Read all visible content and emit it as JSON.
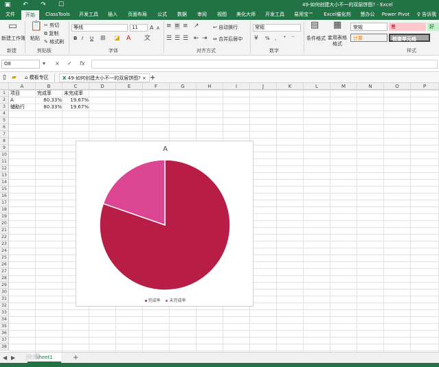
{
  "window": {
    "title": "49-如何创建大小不一的双层饼图? - Excel"
  },
  "quick_access": [
    "save-icon",
    "undo-icon",
    "redo-icon",
    "touch-icon"
  ],
  "ribbon_tabs": [
    "文件",
    "开始",
    "ClassTools",
    "开发工具",
    "插入",
    "页面布局",
    "公式",
    "数据",
    "审阅",
    "视图",
    "美化大师",
    "开发工具",
    "易用宝™",
    "Excel催化剂",
    "慧办公",
    "Power Pivot"
  ],
  "active_tab": "开始",
  "tell_me": "告诉我",
  "ribbon": {
    "groups": [
      "剪贴板",
      "字体",
      "对齐方式",
      "数字",
      "样式"
    ],
    "first_group_label": "新建",
    "new_workbook": "新建工作簿",
    "paste": "粘贴",
    "cut": "剪切",
    "copy": "复制",
    "format_painter": "格式刷",
    "font_name": "等线",
    "font_size": "11",
    "bold": "B",
    "italic": "I",
    "underline": "U",
    "wrap_text": "自动换行",
    "merge_center": "合并后居中",
    "number_format": "常规",
    "percent": "%",
    "comma": ",",
    "conditional_format": "条件格式",
    "table_format": "套用表格格式",
    "styles": [
      {
        "label": "常规",
        "bg": "#ffffff",
        "color": "#222222"
      },
      {
        "label": "差",
        "bg": "#ffc7ce",
        "color": "#9c0006"
      },
      {
        "label": "好",
        "bg": "#c6efce",
        "color": "#006100"
      },
      {
        "label": "计算",
        "bg": "#f2f2f2",
        "color": "#fa7d00"
      },
      {
        "label": "检查单元格",
        "bg": "#a5a5a5",
        "color": "#ffffff"
      }
    ]
  },
  "formula_bar": {
    "name_box": "O8",
    "cancel": "×",
    "enter": "✓",
    "fx": "fx",
    "value": ""
  },
  "file_tabs": {
    "home": "模板专区",
    "current": "49-如何创建大小不一的双层饼图?"
  },
  "columns": [
    "A",
    "B",
    "C",
    "D",
    "E",
    "F",
    "G",
    "H",
    "I",
    "J",
    "K",
    "L",
    "M",
    "N",
    "O",
    "P"
  ],
  "rows_count": 38,
  "cells": {
    "A1": "项目",
    "B1": "完成率",
    "C1": "未完成率",
    "A2": "A",
    "B2": "80.33%",
    "C2": "19.67%",
    "A3": "辅助行",
    "B3": "80.33%",
    "C3": "19.67%"
  },
  "chart_data": {
    "type": "pie",
    "title": "A",
    "categories": [
      "完成率",
      "未完成率"
    ],
    "values": [
      80.33,
      19.67
    ],
    "colors": [
      "#b81e45",
      "#dc4591"
    ],
    "legend_position": "bottom"
  },
  "sheet_tab": "Sheet1",
  "add_sheet": "+",
  "watermark": "大师"
}
